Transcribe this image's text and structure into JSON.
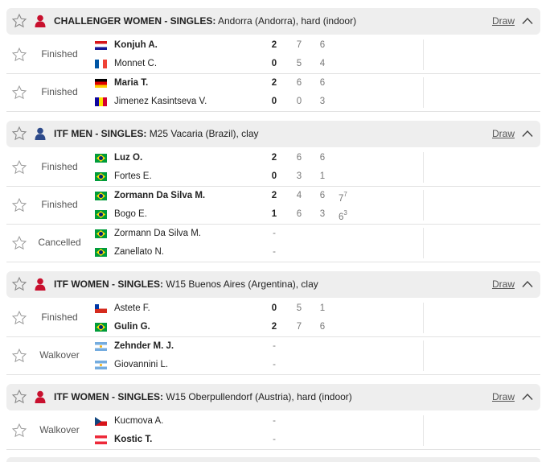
{
  "tournaments": [
    {
      "category": "CHALLENGER WOMEN - SINGLES:",
      "name": "Andorra (Andorra), hard (indoor)",
      "person_color": "#c8102e",
      "draw_label": "Draw",
      "matches": [
        {
          "status": "Finished",
          "players": [
            {
              "name": "Konjuh A.",
              "flag": "croatia",
              "winner": true,
              "sets": "2",
              "games": [
                "7",
                "6"
              ],
              "tiebreaks": []
            },
            {
              "name": "Monnet C.",
              "flag": "france",
              "winner": false,
              "sets": "0",
              "games": [
                "5",
                "4"
              ],
              "tiebreaks": []
            }
          ]
        },
        {
          "status": "Finished",
          "players": [
            {
              "name": "Maria T.",
              "flag": "germany",
              "winner": true,
              "sets": "2",
              "games": [
                "6",
                "6"
              ],
              "tiebreaks": []
            },
            {
              "name": "Jimenez Kasintseva V.",
              "flag": "andorra",
              "winner": false,
              "sets": "0",
              "games": [
                "0",
                "3"
              ],
              "tiebreaks": []
            }
          ]
        }
      ]
    },
    {
      "category": "ITF MEN - SINGLES:",
      "name": "M25 Vacaria (Brazil), clay",
      "person_color": "#2d4a8a",
      "draw_label": "Draw",
      "matches": [
        {
          "status": "Finished",
          "players": [
            {
              "name": "Luz O.",
              "flag": "brazil",
              "winner": true,
              "sets": "2",
              "games": [
                "6",
                "6"
              ],
              "tiebreaks": []
            },
            {
              "name": "Fortes E.",
              "flag": "brazil",
              "winner": false,
              "sets": "0",
              "games": [
                "3",
                "1"
              ],
              "tiebreaks": []
            }
          ]
        },
        {
          "status": "Finished",
          "players": [
            {
              "name": "Zormann Da Silva M.",
              "flag": "brazil",
              "winner": true,
              "sets": "2",
              "games": [
                "4",
                "6",
                "7"
              ],
              "tiebreaks": [
                "",
                "",
                "7"
              ]
            },
            {
              "name": "Bogo E.",
              "flag": "brazil",
              "winner": false,
              "sets": "1",
              "games": [
                "6",
                "3",
                "6"
              ],
              "tiebreaks": [
                "",
                "",
                "3"
              ]
            }
          ]
        },
        {
          "status": "Cancelled",
          "players": [
            {
              "name": "Zormann Da Silva M.",
              "flag": "brazil",
              "winner": false,
              "sets": "-",
              "games": [],
              "tiebreaks": []
            },
            {
              "name": "Zanellato N.",
              "flag": "brazil",
              "winner": false,
              "sets": "-",
              "games": [],
              "tiebreaks": []
            }
          ]
        }
      ]
    },
    {
      "category": "ITF WOMEN - SINGLES:",
      "name": "W15 Buenos Aires (Argentina), clay",
      "person_color": "#c8102e",
      "draw_label": "Draw",
      "matches": [
        {
          "status": "Finished",
          "players": [
            {
              "name": "Astete F.",
              "flag": "chile",
              "winner": false,
              "sets": "0",
              "games": [
                "5",
                "1"
              ],
              "tiebreaks": []
            },
            {
              "name": "Gulin G.",
              "flag": "brazil",
              "winner": true,
              "sets": "2",
              "games": [
                "7",
                "6"
              ],
              "tiebreaks": []
            }
          ]
        },
        {
          "status": "Walkover",
          "players": [
            {
              "name": "Zehnder M. J.",
              "flag": "argentina",
              "winner": true,
              "sets": "-",
              "games": [],
              "tiebreaks": []
            },
            {
              "name": "Giovannini L.",
              "flag": "argentina",
              "winner": false,
              "sets": "-",
              "games": [],
              "tiebreaks": []
            }
          ]
        }
      ]
    },
    {
      "category": "ITF WOMEN - SINGLES:",
      "name": "W15 Oberpullendorf (Austria), hard (indoor)",
      "person_color": "#c8102e",
      "draw_label": "Draw",
      "matches": [
        {
          "status": "Walkover",
          "players": [
            {
              "name": "Kucmova A.",
              "flag": "czech",
              "winner": false,
              "sets": "-",
              "games": [],
              "tiebreaks": []
            },
            {
              "name": "Kostic T.",
              "flag": "austria",
              "winner": true,
              "sets": "-",
              "games": [],
              "tiebreaks": []
            }
          ]
        }
      ]
    }
  ],
  "colors": {
    "header_bg": "#eeeeee",
    "star_outline": "#9a9a9a",
    "women_icon": "#c8102e",
    "men_icon": "#2d4a8a",
    "winner_text": "#222222",
    "score_text": "#777777"
  }
}
